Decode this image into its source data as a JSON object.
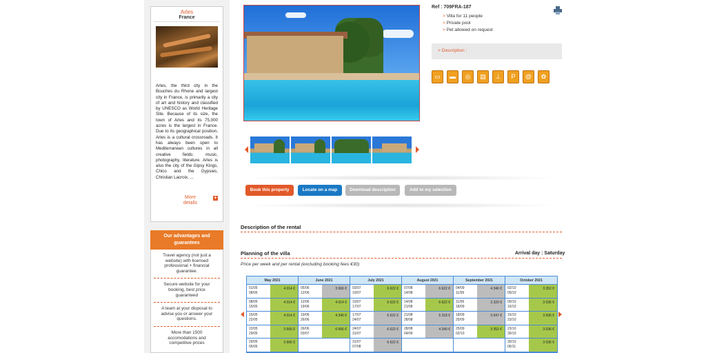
{
  "city": {
    "name": "Arles",
    "country": "France",
    "description": "Arles, the third city in the Bouches du Rhone and largest city in France, is primarily a city of art and history and classified by UNESCO as World Heritage Site. Because of its size, the town of Arles and its 75,000 acres is the largest in France. Due to its geographical position, Arles is a cultural crossroads. It has always been open to Mediterranean cultures in all creative fields: music, photography, literature. Arles is also the city of the Gipsy Kings, Chico and the Gypsies, Christian Lacroix, ...",
    "more_label": "More details"
  },
  "advantages": {
    "title": "Our advantages and guarantees",
    "items": [
      "Travel agency (not just a website) with licensed professional + financial guarantee.",
      "Secure website for your booking, best price guaranteed",
      "A team at your disposal to advise you or answer your questions.",
      "More than 1500 accomodations and competitive prices"
    ]
  },
  "property": {
    "ref": "Ref : 709FRA-187",
    "features": [
      "Villa for 11 people",
      "Private pool",
      "Pet allowed on request"
    ],
    "description_link": "> Description :"
  },
  "amenity_icons": [
    "bed-icon",
    "sofa-icon",
    "washing-machine-icon",
    "dishwasher-icon",
    "iron-icon",
    "parking-icon",
    "internet-icon",
    "pets-icon"
  ],
  "buttons": {
    "book": "Book this property",
    "map": "Locate on a map",
    "download": "Download description",
    "selection": "Add to my selection"
  },
  "sections": {
    "description_title": "Description of the rental",
    "planning_title": "Planning of the villa",
    "arrival_day": "Arrival day : Saturday",
    "price_note": "Price per week and per rental (excluding booking fees €30)"
  },
  "calendar": {
    "months": [
      {
        "name": "May 2021",
        "weeks": [
          {
            "dates": "01/05 08/05",
            "price": "4 014 €",
            "status": "green"
          },
          {
            "dates": "08/05 15/05",
            "price": "4 014 €",
            "status": "green"
          },
          {
            "dates": "15/05 22/05",
            "price": "4 014 €",
            "status": "green"
          },
          {
            "dates": "22/05 29/05",
            "price": "3 666 €",
            "status": "green"
          },
          {
            "dates": "29/05 05/06",
            "price": "3 666 €",
            "status": "green"
          }
        ]
      },
      {
        "name": "June 2021",
        "weeks": [
          {
            "dates": "05/06 12/06",
            "price": "3 666 €",
            "status": "gray"
          },
          {
            "dates": "12/06 19/06",
            "price": "4 014 €",
            "status": "green"
          },
          {
            "dates": "19/06 26/06",
            "price": "4 340 €",
            "status": "green"
          },
          {
            "dates": "26/06 03/07",
            "price": "6 666 €",
            "status": "green"
          },
          {
            "dates": "",
            "price": "",
            "status": "empty"
          }
        ]
      },
      {
        "name": "July 2021",
        "weeks": [
          {
            "dates": "03/07 10/07",
            "price": "6 622 €",
            "status": "green"
          },
          {
            "dates": "10/07 17/07",
            "price": "6 622 €",
            "status": "green"
          },
          {
            "dates": "17/07 24/07",
            "price": "6 622 €",
            "status": "gray"
          },
          {
            "dates": "24/07 31/07",
            "price": "6 622 €",
            "status": "gray"
          },
          {
            "dates": "31/07 07/08",
            "price": "6 622 €",
            "status": "gray"
          }
        ]
      },
      {
        "name": "August 2021",
        "weeks": [
          {
            "dates": "07/08 14/08",
            "price": "6 622 €",
            "status": "gray"
          },
          {
            "dates": "14/08 21/08",
            "price": "6 622 €",
            "status": "green"
          },
          {
            "dates": "21/08 28/08",
            "price": "5 318 €",
            "status": "gray"
          },
          {
            "dates": "28/08 04/09",
            "price": "4 340 €",
            "status": "gray"
          },
          {
            "dates": "",
            "price": "",
            "status": "empty"
          }
        ]
      },
      {
        "name": "September 2021",
        "weeks": [
          {
            "dates": "04/09 11/09",
            "price": "4 340 €",
            "status": "gray"
          },
          {
            "dates": "11/09 18/09",
            "price": "3 320 €",
            "status": "gray"
          },
          {
            "dates": "18/09 25/09",
            "price": "3 047 €",
            "status": "gray"
          },
          {
            "dates": "25/09 02/10",
            "price": "3 352 €",
            "status": "green"
          },
          {
            "dates": "",
            "price": "",
            "status": "empty"
          }
        ]
      },
      {
        "name": "October 2021",
        "weeks": [
          {
            "dates": "02/10 09/10",
            "price": "3 352 €",
            "status": "green"
          },
          {
            "dates": "09/10 16/10",
            "price": "3 036 €",
            "status": "green"
          },
          {
            "dates": "16/10 23/10",
            "price": "3 036 €",
            "status": "green"
          },
          {
            "dates": "23/10 30/10",
            "price": "3 036 €",
            "status": "green"
          },
          {
            "dates": "30/10 06/11",
            "price": "3 036 €",
            "status": "green"
          }
        ]
      }
    ]
  }
}
